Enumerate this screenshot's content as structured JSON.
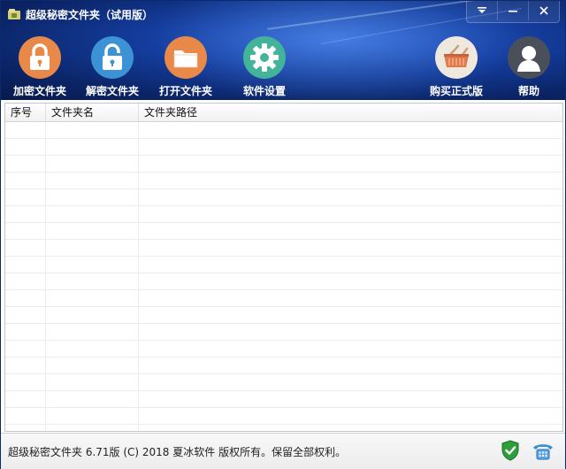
{
  "window": {
    "title": "超级秘密文件夹（试用版）",
    "controls": [
      "menu-dropdown-icon",
      "minimize-icon",
      "close-icon"
    ]
  },
  "toolbar": {
    "items": [
      {
        "label": "加密文件夹",
        "icon": "lock-icon",
        "color": "#e8894a"
      },
      {
        "label": "解密文件夹",
        "icon": "unlock-icon",
        "color": "#3b93d6"
      },
      {
        "label": "打开文件夹",
        "icon": "folder-icon",
        "color": "#e8894a"
      },
      {
        "label": "软件设置",
        "icon": "gear-icon",
        "color": "#43b39a"
      },
      {
        "label": "购买正式版",
        "icon": "basket-icon",
        "color": "#efe8df"
      },
      {
        "label": "帮助",
        "icon": "user-icon",
        "color": "#4a4f5a"
      }
    ]
  },
  "table": {
    "columns": [
      "序号",
      "文件夹名",
      "文件夹路径"
    ],
    "rows": []
  },
  "status": {
    "text": "超级秘密文件夹 6.71版 (C) 2018 夏冰软件 版权所有。保留全部权利。",
    "icons": [
      "shield-check-icon",
      "telephone-icon"
    ]
  }
}
